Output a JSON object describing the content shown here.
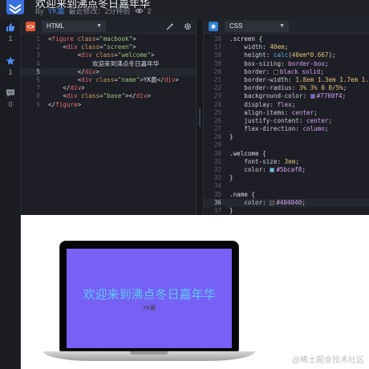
{
  "header": {
    "title": "欢迎来到沸点冬日嘉年华",
    "by_label": "By",
    "author": "YK菌",
    "last_modified": "最近修改：2分钟前",
    "views": "2"
  },
  "rail": {
    "like_count": "1",
    "star_count": "1",
    "comment_count": "0"
  },
  "html_editor": {
    "language": "HTML",
    "lines": [
      {
        "n": "1"
      },
      {
        "n": "2"
      },
      {
        "n": "3"
      },
      {
        "n": "4"
      },
      {
        "n": "5"
      },
      {
        "n": "6"
      },
      {
        "n": "7"
      },
      {
        "n": "8"
      },
      {
        "n": "9"
      }
    ]
  },
  "css_editor": {
    "language": "CSS",
    "lines": [
      {
        "n": "16"
      },
      {
        "n": "17"
      },
      {
        "n": "18"
      },
      {
        "n": "19"
      },
      {
        "n": "20"
      },
      {
        "n": "21"
      },
      {
        "n": "22"
      },
      {
        "n": "23"
      },
      {
        "n": "24"
      },
      {
        "n": "25"
      },
      {
        "n": "26"
      },
      {
        "n": "27"
      },
      {
        "n": "28"
      },
      {
        "n": "29"
      },
      {
        "n": "30"
      },
      {
        "n": "31"
      },
      {
        "n": "32"
      },
      {
        "n": "33"
      },
      {
        "n": "34"
      },
      {
        "n": "35"
      },
      {
        "n": "36"
      },
      {
        "n": "37"
      }
    ]
  },
  "preview": {
    "welcome_text": "欢迎来到沸点冬日嘉年华",
    "name_text": "YK菌",
    "watermark": "@稀土掘金技术社区"
  },
  "colors": {
    "screen_bg": "#7760f4",
    "welcome": "#5bcaf8",
    "name": "#404040",
    "accent": "#4c8cf5"
  }
}
